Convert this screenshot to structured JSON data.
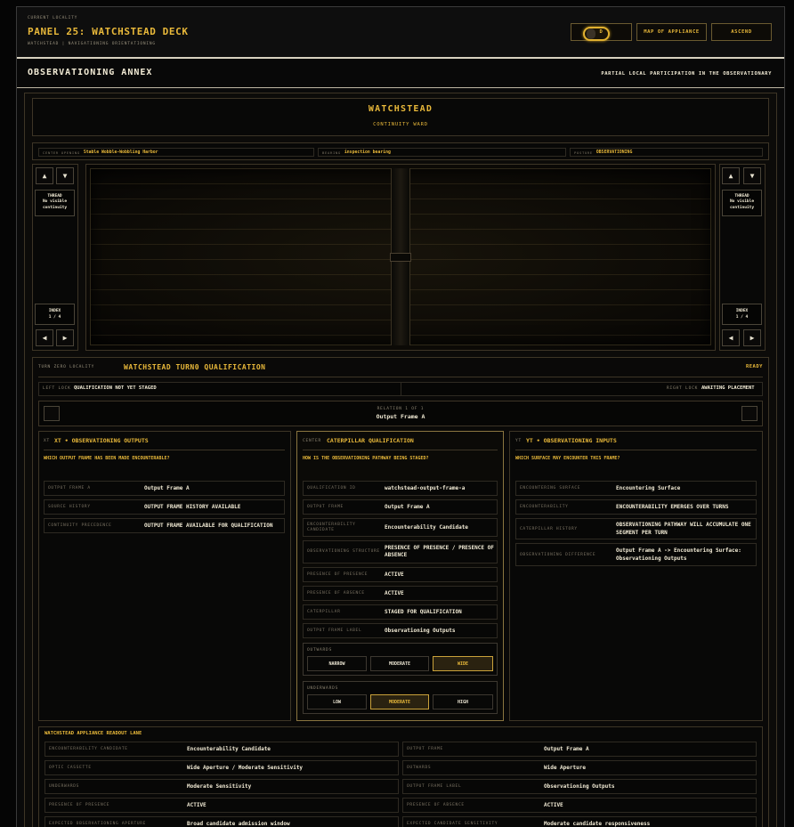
{
  "header": {
    "eyebrow": "CURRENT LOCALITY",
    "title": "PANEL 25: WATCHSTEAD DECK",
    "subtitle": "WATCHSTEAD | NAVIGATIONING ORIENTATIONING",
    "nav": [
      "D",
      "MAP OF APPLIANCE",
      "ASCEND"
    ]
  },
  "annex": {
    "title": "OBSERVATIONING ANNEX",
    "right": "PARTIAL LOCAL PARTICIPATION IN THE OBSERVATIONARY"
  },
  "ward": {
    "title": "WATCHSTEAD",
    "subtitle": "CONTINUITY WARD"
  },
  "statusbar": [
    {
      "k": "CENTER OPENING",
      "v": "Stable Wobble-Wobbling Harbor"
    },
    {
      "k": "BEARING",
      "v": "inspection bearing"
    },
    {
      "k": "POSTURE",
      "v": "OBSERVATIONING"
    }
  ],
  "side_left": {
    "thread_title": "THREAD",
    "thread_text": "No visible continuity",
    "index_label": "INDEX",
    "index_value": "1 / 4"
  },
  "side_right": {
    "thread_title": "THREAD",
    "thread_text": "No visible continuity",
    "index_label": "INDEX",
    "index_value": "1 / 4"
  },
  "turn": {
    "locality_label": "TURN ZERO LOCALITY",
    "title": "WATCHSTEAD TURN0 QUALIFICATION",
    "status": "READY",
    "left_lock_label": "LEFT LOCK",
    "left_lock_value": "QUALIFICATION NOT YET STAGED",
    "right_lock_label": "RIGHT LOCK",
    "right_lock_value": "AWAITING PLACEMENT",
    "relation_label": "RELATION 1 OF 1",
    "relation_value": "Output Frame A"
  },
  "col_xt": {
    "tag": "XT",
    "title": "XT • OBSERVATIONING OUTPUTS",
    "question": "WHICH OUTPUT FRAME HAS BEEN MADE ENCOUNTERABLE?",
    "rows": [
      {
        "k": "OUTPUT FRAME A",
        "v": "Output Frame A"
      },
      {
        "k": "SOURCE HISTORY",
        "v": "OUTPUT FRAME HISTORY AVAILABLE"
      },
      {
        "k": "CONTINUITY PRECEDENCE",
        "v": "OUTPUT FRAME AVAILABLE FOR QUALIFICATION"
      }
    ]
  },
  "col_center": {
    "tag": "CENTER",
    "title": "CATERPILLAR QUALIFICATION",
    "question": "HOW IS THE OBSERVATIONING PATHWAY BEING STAGED?",
    "rows": [
      {
        "k": "QUALIFICATION ID",
        "v": "watchstead-output-frame-a"
      },
      {
        "k": "OUTPUT FRAME",
        "v": "Output Frame A"
      },
      {
        "k": "ENCOUNTERABILITY CANDIDATE",
        "v": "Encounterability Candidate"
      },
      {
        "k": "OBSERVATIONING STRUCTURE",
        "v": "PRESENCE OF PRESENCE / PRESENCE OF ABSENCE"
      },
      {
        "k": "PRESENCE OF PRESENCE",
        "v": "ACTIVE"
      },
      {
        "k": "PRESENCE OF ABSENCE",
        "v": "ACTIVE"
      },
      {
        "k": "CATERPILLAR",
        "v": "STAGED FOR QUALIFICATION"
      },
      {
        "k": "OUTPUT FRAME LABEL",
        "v": "Observationing Outputs"
      }
    ],
    "outwards_label": "OUTWARDS",
    "outwards": [
      "NARROW",
      "MODERATE",
      "WIDE"
    ],
    "outwards_selected": "WIDE",
    "underwards_label": "UNDERWARDS",
    "underwards": [
      "LOW",
      "MODERATE",
      "HIGH"
    ],
    "underwards_selected": "MODERATE"
  },
  "col_yt": {
    "tag": "YT",
    "title": "YT • OBSERVATIONING INPUTS",
    "question": "WHICH SURFACE MAY ENCOUNTER THIS FRAME?",
    "rows": [
      {
        "k": "ENCOUNTERING SURFACE",
        "v": "Encountering Surface"
      },
      {
        "k": "ENCOUNTERABILITY",
        "v": "ENCOUNTERABILITY EMERGES OVER TURNS"
      },
      {
        "k": "CATERPILLAR HISTORY",
        "v": "OBSERVATIONING PATHWAY WILL ACCUMULATE ONE SEGMENT PER TURN"
      },
      {
        "k": "OBSERVATIONING DIFFERENCE",
        "v": "Output Frame A -> Encountering Surface: Observationing Outputs"
      }
    ]
  },
  "readout": {
    "title": "WATCHSTEAD APPLIANCE READOUT LANE",
    "left": [
      {
        "k": "ENCOUNTERABILITY CANDIDATE",
        "v": "Encounterability Candidate"
      },
      {
        "k": "OPTIC CASSETTE",
        "v": "Wide Aperture / Moderate Sensitivity"
      },
      {
        "k": "UNDERWARDS",
        "v": "Moderate Sensitivity"
      },
      {
        "k": "PRESENCE OF PRESENCE",
        "v": "ACTIVE"
      },
      {
        "k": "EXPECTED OBSERVATIONING APERTURE",
        "v": "Broad candidate admission window"
      }
    ],
    "right": [
      {
        "k": "OUTPUT FRAME",
        "v": "Output Frame A"
      },
      {
        "k": "OUTWARDS",
        "v": "Wide Aperture"
      },
      {
        "k": "OUTPUT FRAME LABEL",
        "v": "Observationing Outputs"
      },
      {
        "k": "PRESENCE OF ABSENCE",
        "v": "ACTIVE"
      },
      {
        "k": "EXPECTED CANDIDATE SENSITIVITY",
        "v": "Moderate candidate responsiveness"
      }
    ]
  },
  "glyphs": {
    "up": "▲",
    "down": "▼",
    "left": "◀",
    "right": "▶"
  }
}
